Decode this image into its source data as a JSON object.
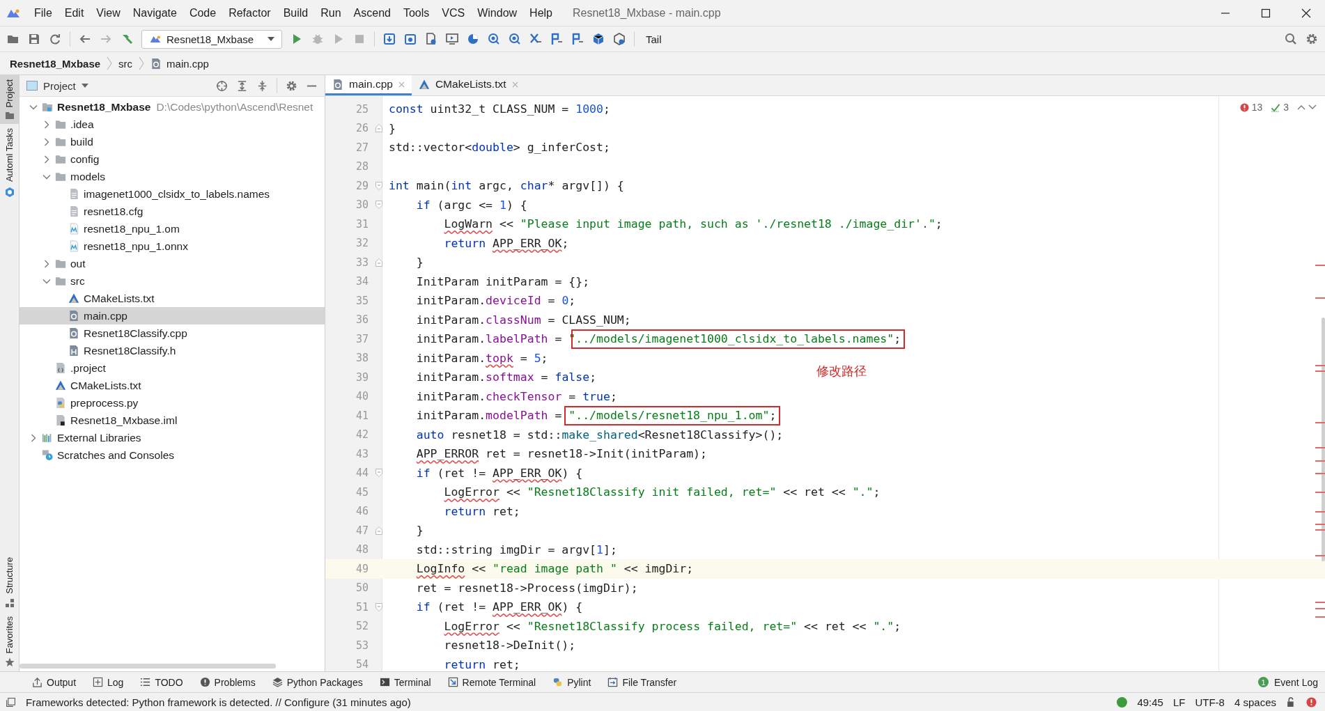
{
  "window": {
    "title": "Resnet18_Mxbase - main.cpp"
  },
  "menu": [
    "File",
    "Edit",
    "View",
    "Navigate",
    "Code",
    "Refactor",
    "Build",
    "Run",
    "Ascend",
    "Tools",
    "VCS",
    "Window",
    "Help"
  ],
  "toolbar": {
    "run_config": "Resnet18_Mxbase",
    "tail": "Tail"
  },
  "breadcrumb": [
    {
      "label": "Resnet18_Mxbase",
      "kind": "project"
    },
    {
      "label": "src",
      "kind": "folder"
    },
    {
      "label": "main.cpp",
      "kind": "cpp"
    }
  ],
  "left_tool_tabs_top": [
    {
      "label": "Project",
      "kind": "project",
      "selected": true
    },
    {
      "label": "Automl Tasks",
      "kind": "automl",
      "selected": false
    }
  ],
  "left_tool_tabs_bottom": [
    {
      "label": "Structure",
      "kind": "structure",
      "selected": false
    },
    {
      "label": "Favorites",
      "kind": "favorites",
      "selected": false
    }
  ],
  "project_panel": {
    "title": "Project",
    "tree": [
      {
        "label": "Resnet18_Mxbase",
        "path": "D:\\Codes\\python\\Ascend\\Resnet",
        "kind": "project",
        "expanded": true,
        "selected": false,
        "children": [
          {
            "label": ".idea",
            "kind": "folder",
            "expanded": false,
            "selected": false
          },
          {
            "label": "build",
            "kind": "folder",
            "expanded": false,
            "selected": false
          },
          {
            "label": "config",
            "kind": "folder",
            "expanded": false,
            "selected": false
          },
          {
            "label": "models",
            "kind": "folder",
            "expanded": true,
            "selected": false,
            "children": [
              {
                "label": "imagenet1000_clsidx_to_labels.names",
                "kind": "text",
                "selected": false
              },
              {
                "label": "resnet18.cfg",
                "kind": "text",
                "selected": false
              },
              {
                "label": "resnet18_npu_1.om",
                "kind": "module",
                "selected": false
              },
              {
                "label": "resnet18_npu_1.onnx",
                "kind": "module",
                "selected": false
              }
            ]
          },
          {
            "label": "out",
            "kind": "folder",
            "expanded": false,
            "selected": false
          },
          {
            "label": "src",
            "kind": "folder",
            "expanded": true,
            "selected": false,
            "children": [
              {
                "label": "CMakeLists.txt",
                "kind": "cmake",
                "selected": false
              },
              {
                "label": "main.cpp",
                "kind": "cpp",
                "selected": true
              },
              {
                "label": "Resnet18Classify.cpp",
                "kind": "cpp",
                "selected": false
              },
              {
                "label": "Resnet18Classify.h",
                "kind": "header",
                "selected": false
              }
            ]
          },
          {
            "label": ".project",
            "kind": "projectfile",
            "selected": false
          },
          {
            "label": "CMakeLists.txt",
            "kind": "cmake",
            "selected": false
          },
          {
            "label": "preprocess.py",
            "kind": "python",
            "selected": false
          },
          {
            "label": "Resnet18_Mxbase.iml",
            "kind": "iml",
            "selected": false
          }
        ]
      },
      {
        "label": "External Libraries",
        "kind": "libraries",
        "expanded": false,
        "selected": false
      },
      {
        "label": "Scratches and Consoles",
        "kind": "scratches",
        "selected": false
      }
    ]
  },
  "editor_tabs": [
    {
      "label": "main.cpp",
      "kind": "cpp",
      "selected": true
    },
    {
      "label": "CMakeLists.txt",
      "kind": "cmake",
      "selected": false
    }
  ],
  "editor": {
    "inspection": {
      "errors": "13",
      "checks": "3"
    },
    "annotation": "修改路径",
    "lines": [
      {
        "n": "25",
        "current": false,
        "tokens": [
          {
            "kind": "kw",
            "text": "const"
          },
          {
            "kind": "plain",
            "text": " uint32_t CLASS_NUM = "
          },
          {
            "kind": "num",
            "text": "1000"
          },
          {
            "kind": "plain",
            "text": ";"
          }
        ]
      },
      {
        "n": "26",
        "current": false,
        "fold_close": true,
        "tokens": [
          {
            "kind": "plain",
            "text": "}"
          }
        ]
      },
      {
        "n": "27",
        "current": false,
        "tokens": [
          {
            "kind": "plain",
            "text": "std::vector<"
          },
          {
            "kind": "kw",
            "text": "double"
          },
          {
            "kind": "plain",
            "text": "> g_inferCost;"
          }
        ]
      },
      {
        "n": "28",
        "current": false
      },
      {
        "n": "29",
        "current": false,
        "fold_open": true,
        "tokens": [
          {
            "kind": "kw",
            "text": "int"
          },
          {
            "kind": "plain",
            "text": " main("
          },
          {
            "kind": "kw",
            "text": "int"
          },
          {
            "kind": "plain",
            "text": " argc, "
          },
          {
            "kind": "kw",
            "text": "char"
          },
          {
            "kind": "plain",
            "text": "* argv[]) {"
          }
        ]
      },
      {
        "n": "30",
        "current": false,
        "fold_open": true,
        "tokens": [
          {
            "kind": "kw",
            "text": "    if"
          },
          {
            "kind": "plain",
            "text": " (argc <= "
          },
          {
            "kind": "num",
            "text": "1"
          },
          {
            "kind": "plain",
            "text": ") {"
          }
        ]
      },
      {
        "n": "31",
        "current": false,
        "tokens": [
          {
            "kind": "err",
            "text": "        LogWarn"
          },
          {
            "kind": "plain",
            "text": " << "
          },
          {
            "kind": "str",
            "text": "\"Please input image path, such as './resnet18 ./image_dir'.\""
          },
          {
            "kind": "plain",
            "text": ";"
          }
        ]
      },
      {
        "n": "32",
        "current": false,
        "tokens": [
          {
            "kind": "kw",
            "text": "        return"
          },
          {
            "kind": "err",
            "text": " APP_ERR_OK"
          },
          {
            "kind": "plain",
            "text": ";"
          }
        ]
      },
      {
        "n": "33",
        "current": false,
        "fold_close": true,
        "tokens": [
          {
            "kind": "plain",
            "text": "    }"
          }
        ]
      },
      {
        "n": "34",
        "current": false,
        "tokens": [
          {
            "kind": "plain",
            "text": "    InitParam initParam = {};"
          }
        ]
      },
      {
        "n": "35",
        "current": false,
        "tokens": [
          {
            "kind": "plain",
            "text": "    initParam."
          },
          {
            "kind": "field",
            "text": "deviceId"
          },
          {
            "kind": "plain",
            "text": " = "
          },
          {
            "kind": "num",
            "text": "0"
          },
          {
            "kind": "plain",
            "text": ";"
          }
        ]
      },
      {
        "n": "36",
        "current": false,
        "tokens": [
          {
            "kind": "plain",
            "text": "    initParam."
          },
          {
            "kind": "field",
            "text": "classNum"
          },
          {
            "kind": "plain",
            "text": " = CLASS_NUM;"
          }
        ]
      },
      {
        "n": "37",
        "current": false,
        "tokens": [
          {
            "kind": "plain",
            "text": "    initParam."
          },
          {
            "kind": "field",
            "text": "labelPath"
          },
          {
            "kind": "plain",
            "text": " = "
          },
          {
            "kind": "str",
            "text": "\""
          },
          {
            "kind": "str",
            "text": "../models/imagenet1000_clsidx_to_labels.names\"",
            "boxed": true
          },
          {
            "kind": "plain",
            "text": ";",
            "boxed": true
          }
        ]
      },
      {
        "n": "38",
        "current": false,
        "tokens": [
          {
            "kind": "plain",
            "text": "    initParam."
          },
          {
            "kind": "fieldwarn",
            "text": "topk"
          },
          {
            "kind": "plain",
            "text": " = "
          },
          {
            "kind": "num",
            "text": "5"
          },
          {
            "kind": "plain",
            "text": ";"
          }
        ]
      },
      {
        "n": "39",
        "current": false,
        "annotated": true,
        "tokens": [
          {
            "kind": "plain",
            "text": "    initParam."
          },
          {
            "kind": "field",
            "text": "softmax"
          },
          {
            "kind": "plain",
            "text": " = "
          },
          {
            "kind": "kw",
            "text": "false"
          },
          {
            "kind": "plain",
            "text": ";"
          }
        ]
      },
      {
        "n": "40",
        "current": false,
        "tokens": [
          {
            "kind": "plain",
            "text": "    initParam."
          },
          {
            "kind": "field",
            "text": "checkTensor"
          },
          {
            "kind": "plain",
            "text": " = "
          },
          {
            "kind": "kw",
            "text": "true"
          },
          {
            "kind": "plain",
            "text": ";"
          }
        ]
      },
      {
        "n": "41",
        "current": false,
        "tokens": [
          {
            "kind": "plain",
            "text": "    initParam."
          },
          {
            "kind": "field",
            "text": "modelPath"
          },
          {
            "kind": "plain",
            "text": " = "
          },
          {
            "kind": "str",
            "text": "\"../models/resnet18_npu_1.om\"",
            "boxed": true
          },
          {
            "kind": "plain",
            "text": ";",
            "boxed": true
          }
        ]
      },
      {
        "n": "42",
        "current": false,
        "tokens": [
          {
            "kind": "kw",
            "text": "    auto"
          },
          {
            "kind": "plain",
            "text": " resnet18 = std::"
          },
          {
            "kind": "fn",
            "text": "make_shared"
          },
          {
            "kind": "plain",
            "text": "<Resnet18Classify>();"
          }
        ]
      },
      {
        "n": "43",
        "current": false,
        "tokens": [
          {
            "kind": "err",
            "text": "    APP_ERROR"
          },
          {
            "kind": "plain",
            "text": " ret = resnet18->Init(initParam);"
          }
        ]
      },
      {
        "n": "44",
        "current": false,
        "fold_open": true,
        "tokens": [
          {
            "kind": "kw",
            "text": "    if"
          },
          {
            "kind": "plain",
            "text": " (ret != "
          },
          {
            "kind": "err",
            "text": "APP_ERR_OK"
          },
          {
            "kind": "plain",
            "text": ") {"
          }
        ]
      },
      {
        "n": "45",
        "current": false,
        "tokens": [
          {
            "kind": "err",
            "text": "        LogError"
          },
          {
            "kind": "plain",
            "text": " << "
          },
          {
            "kind": "str",
            "text": "\"Resnet18Classify init failed, ret=\""
          },
          {
            "kind": "plain",
            "text": " << ret << "
          },
          {
            "kind": "str",
            "text": "\".\""
          },
          {
            "kind": "plain",
            "text": ";"
          }
        ]
      },
      {
        "n": "46",
        "current": false,
        "tokens": [
          {
            "kind": "kw",
            "text": "        return"
          },
          {
            "kind": "plain",
            "text": " ret;"
          }
        ]
      },
      {
        "n": "47",
        "current": false,
        "fold_close": true,
        "tokens": [
          {
            "kind": "plain",
            "text": "    }"
          }
        ]
      },
      {
        "n": "48",
        "current": false,
        "tokens": [
          {
            "kind": "plain",
            "text": "    std::string imgDir = argv["
          },
          {
            "kind": "num",
            "text": "1"
          },
          {
            "kind": "plain",
            "text": "];"
          }
        ]
      },
      {
        "n": "49",
        "current": true,
        "tokens": [
          {
            "kind": "err",
            "text": "    LogInfo"
          },
          {
            "kind": "plain",
            "text": " << "
          },
          {
            "kind": "str",
            "text": "\"read image path \""
          },
          {
            "kind": "plain",
            "text": " << imgDir;"
          }
        ]
      },
      {
        "n": "50",
        "current": false,
        "tokens": [
          {
            "kind": "plain",
            "text": "    ret = resnet18->Process(imgDir);"
          }
        ]
      },
      {
        "n": "51",
        "current": false,
        "fold_open": true,
        "tokens": [
          {
            "kind": "kw",
            "text": "    if"
          },
          {
            "kind": "plain",
            "text": " (ret != "
          },
          {
            "kind": "err",
            "text": "APP_ERR_OK"
          },
          {
            "kind": "plain",
            "text": ") {"
          }
        ]
      },
      {
        "n": "52",
        "current": false,
        "tokens": [
          {
            "kind": "err",
            "text": "        LogError"
          },
          {
            "kind": "plain",
            "text": " << "
          },
          {
            "kind": "str",
            "text": "\"Resnet18Classify process failed, ret=\""
          },
          {
            "kind": "plain",
            "text": " << ret << "
          },
          {
            "kind": "str",
            "text": "\".\""
          },
          {
            "kind": "plain",
            "text": ";"
          }
        ]
      },
      {
        "n": "53",
        "current": false,
        "tokens": [
          {
            "kind": "plain",
            "text": "        resnet18->DeInit();"
          }
        ]
      },
      {
        "n": "54",
        "current": false,
        "tokens": [
          {
            "kind": "kw",
            "text": "        return"
          },
          {
            "kind": "plain",
            "text": " ret;"
          }
        ]
      }
    ]
  },
  "tool_windows": [
    {
      "label": "Output",
      "kind": "output"
    },
    {
      "label": "Log",
      "kind": "log"
    },
    {
      "label": "TODO",
      "kind": "todo"
    },
    {
      "label": "Problems",
      "kind": "problems"
    },
    {
      "label": "Python Packages",
      "kind": "packages"
    },
    {
      "label": "Terminal",
      "kind": "terminal"
    },
    {
      "label": "Remote Terminal",
      "kind": "remote"
    },
    {
      "label": "Pylint",
      "kind": "pylint"
    },
    {
      "label": "File Transfer",
      "kind": "transfer"
    }
  ],
  "event_log": {
    "label": "Event Log",
    "count": "1"
  },
  "status_bar": {
    "message": "Frameworks detected: Python framework is detected. // Configure (31 minutes ago)",
    "position": "49:45",
    "line_separator": "LF",
    "encoding": "UTF-8",
    "indent": "4 spaces"
  }
}
